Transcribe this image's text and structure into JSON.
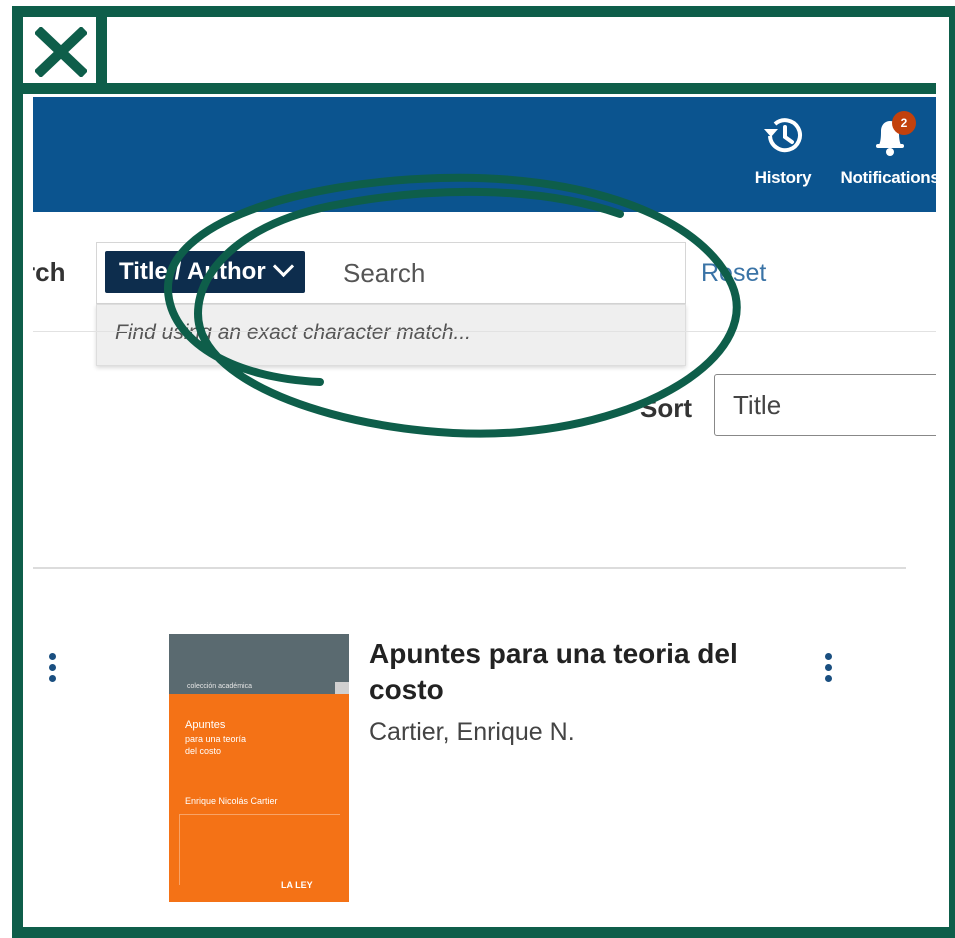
{
  "header": {
    "history_label": "History",
    "notifications_label": "Notifications",
    "notification_count": "2",
    "brand_color": "#0b548f"
  },
  "search": {
    "label": "rch",
    "scope_label": "Title / Author",
    "placeholder": "Search",
    "suggestion": "Find using an exact character match...",
    "reset_label": "Reset"
  },
  "sort": {
    "label": "Sort",
    "selected": "Title"
  },
  "result": {
    "title": "Apuntes para una teoria del costo",
    "author": "Cartier, Enrique N.",
    "cover": {
      "collection": "colección académica",
      "title_line1": "Apuntes",
      "title_line2": "para una teoría",
      "title_line3": "del costo",
      "author": "Enrique Nicolás Cartier",
      "publisher": "LA LEY"
    }
  },
  "icons": {
    "close": "close-icon",
    "history": "history-icon",
    "notifications": "bell-icon",
    "more": "kebab-menu-icon"
  },
  "colors": {
    "frame": "#0e5e4a",
    "scope_button": "#0d2d4d",
    "link": "#3a73a6",
    "badge": "#c2410c",
    "cover": "#f47216"
  }
}
